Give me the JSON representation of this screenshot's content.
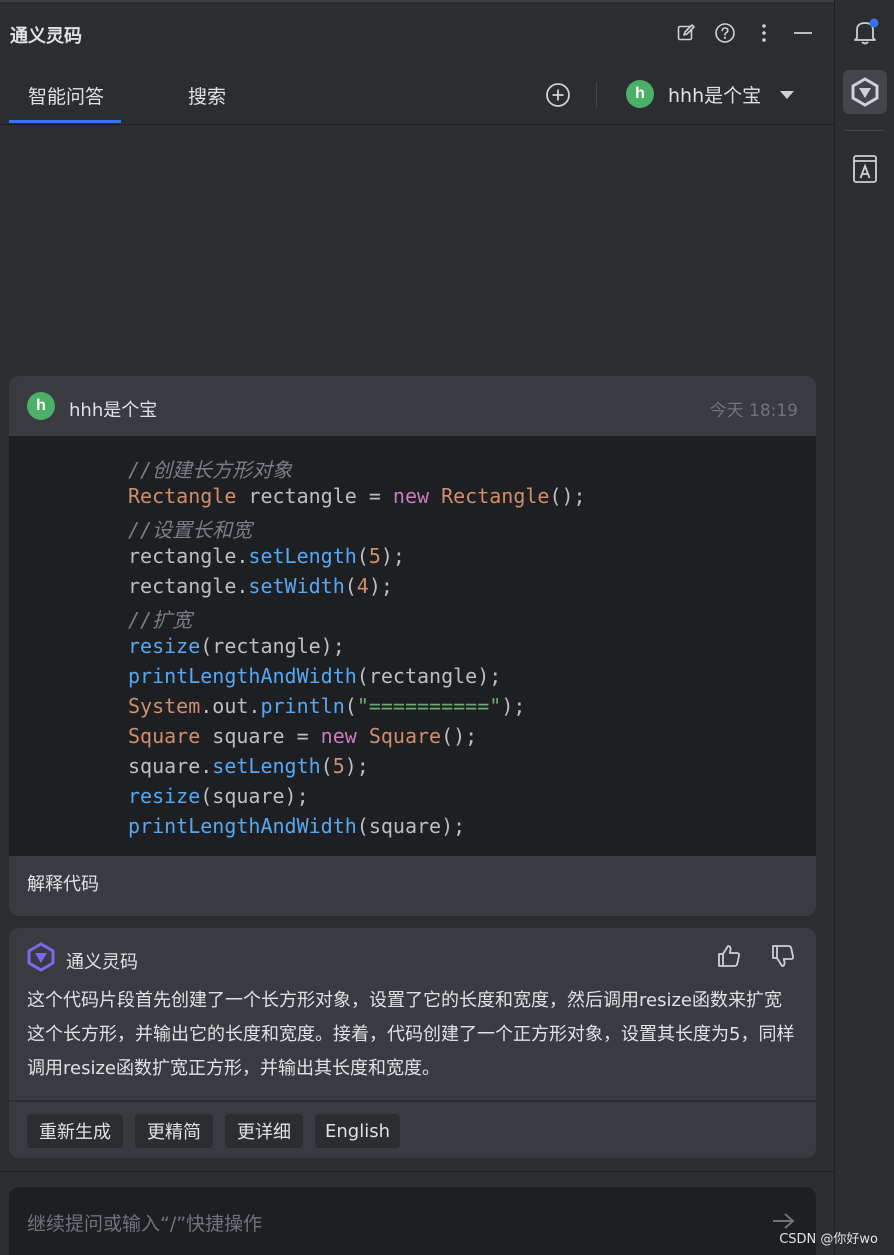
{
  "app": {
    "title": "通义灵码"
  },
  "tabs": [
    {
      "label": "智能问答",
      "active": true
    },
    {
      "label": "搜索",
      "active": false
    }
  ],
  "user": {
    "avatar_letter": "h",
    "name": "hhh是个宝"
  },
  "user_message": {
    "avatar_letter": "h",
    "name": "hhh是个宝",
    "time": "今天 18:19",
    "action_label": "解释代码"
  },
  "code_lines": [
    "//创建长方形对象",
    "Rectangle rectangle = new Rectangle();",
    "//设置长和宽",
    "rectangle.setLength(5);",
    "rectangle.setWidth(4);",
    "//扩宽",
    "resize(rectangle);",
    "printLengthAndWidth(rectangle);",
    "System.out.println(\"==========\");",
    "Square square = new Square();",
    "square.setLength(5);",
    "resize(square);",
    "printLengthAndWidth(square);"
  ],
  "assistant_message": {
    "name": "通义灵码",
    "text": "这个代码片段首先创建了一个长方形对象，设置了它的长度和宽度，然后调用resize函数来扩宽这个长方形，并输出它的长度和宽度。接着，代码创建了一个正方形对象，设置其长度为5，同样调用resize函数扩宽正方形，并输出其长度和宽度。",
    "actions": [
      "重新生成",
      "更精简",
      "更详细",
      "English"
    ]
  },
  "input": {
    "placeholder": "继续提问或输入“/”快捷操作"
  },
  "watermark": "CSDN @你好wo",
  "colors": {
    "accent": "#3574f0",
    "avatar": "#4caf68",
    "panel": "#2b2d30",
    "card": "#393b40",
    "code_bg": "#1e1f22",
    "notification_dot": "#3574f0"
  }
}
